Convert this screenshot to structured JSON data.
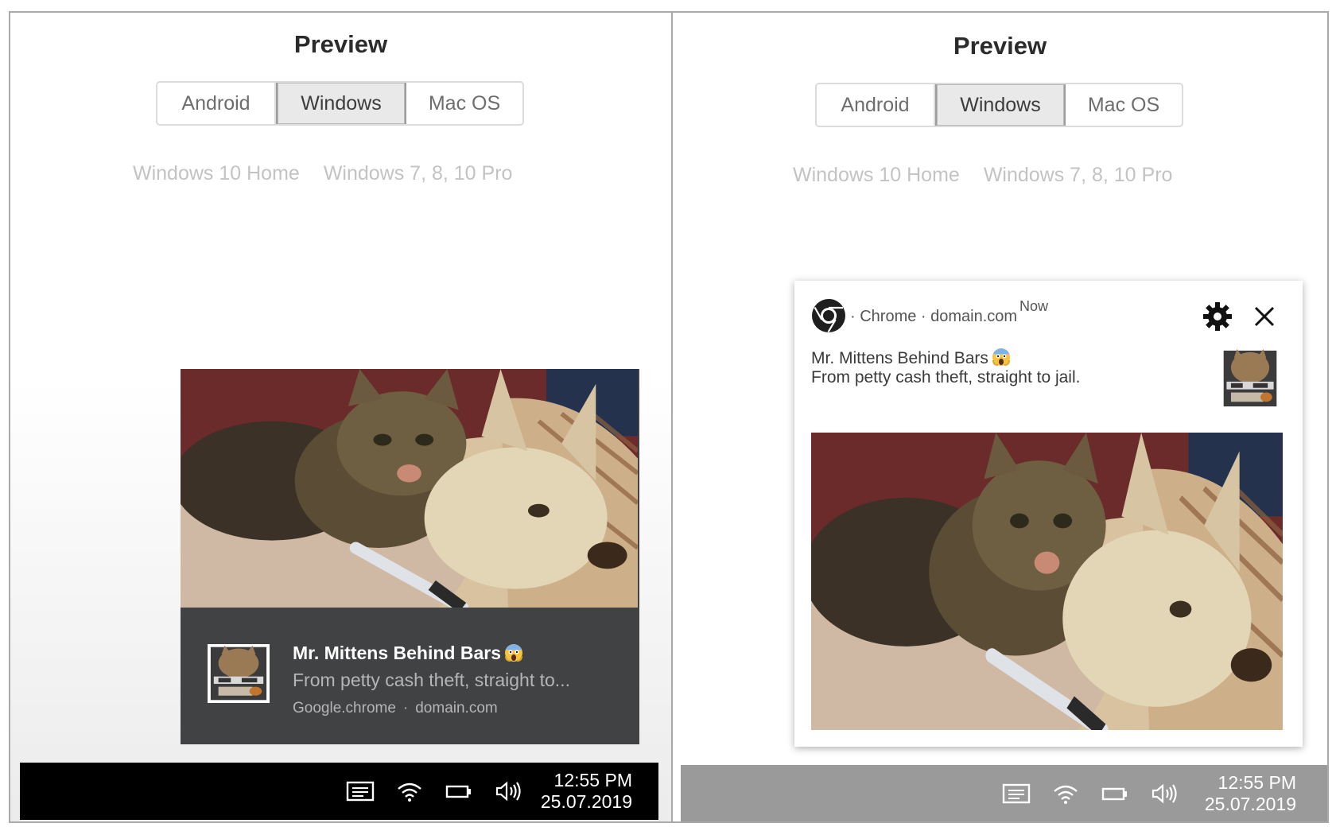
{
  "left_panel": {
    "title": "Preview",
    "platform_tabs": [
      {
        "label": "Android",
        "active": false
      },
      {
        "label": "Windows",
        "active": true
      },
      {
        "label": "Mac OS",
        "active": false
      }
    ],
    "os_versions": [
      "Windows 10 Home",
      "Windows 7, 8, 10 Pro"
    ],
    "toast": {
      "title": "Mr. Mittens Behind Bars",
      "body": "From petty cash theft, straight to...",
      "app": "Google.chrome",
      "separator": "·",
      "domain": "domain.com"
    },
    "taskbar": {
      "time": "12:55 PM",
      "date": "25.07.2019"
    }
  },
  "right_panel": {
    "title": "Preview",
    "platform_tabs": [
      {
        "label": "Android",
        "active": false
      },
      {
        "label": "Windows",
        "active": true
      },
      {
        "label": "Mac OS",
        "active": false
      }
    ],
    "os_versions": [
      "Windows 10 Home",
      "Windows 7, 8, 10 Pro"
    ],
    "notification": {
      "header": "· Chrome · domain.com",
      "time": "Now",
      "title": "Mr. Mittens Behind Bars",
      "body": "From petty cash theft, straight to jail."
    },
    "taskbar": {
      "time": "12:55 PM",
      "date": "25.07.2019"
    }
  },
  "icons": [
    "notification-center-icon",
    "wifi-icon",
    "battery-icon",
    "volume-icon",
    "chrome-logo-icon",
    "gear-icon",
    "close-icon",
    "scream-emoji-icon"
  ],
  "colors": {
    "toast_bg": "#414244",
    "taskbar_dark": "#000000",
    "taskbar_light": "#9a9a9a"
  }
}
